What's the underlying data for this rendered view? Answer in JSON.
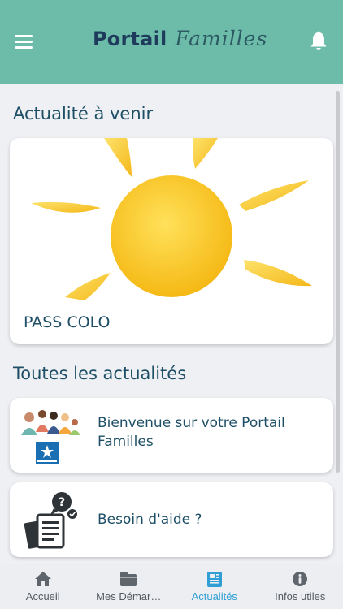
{
  "header": {
    "app_name_main": "Portail",
    "app_name_script": "Familles",
    "menu_icon": "hamburger-icon",
    "bell_icon": "bell-icon"
  },
  "upcoming": {
    "section_title": "Actualité à venir",
    "featured": {
      "title": "PASS COLO",
      "image": "sun-illustration"
    }
  },
  "all_news": {
    "section_title": "Toutes les actualités",
    "items": [
      {
        "title_line1": "Bienvenue sur votre Portail",
        "title_line2": "Familles",
        "image": "families-caf-illustration"
      },
      {
        "title_line1": "Besoin d'aide ?",
        "title_line2": "",
        "image": "help-documents-icon"
      }
    ]
  },
  "tabs": [
    {
      "label": "Accueil",
      "icon": "home-icon",
      "active": false
    },
    {
      "label": "Mes Démar…",
      "icon": "folder-icon",
      "active": false
    },
    {
      "label": "Actualités",
      "icon": "newspaper-icon",
      "active": true
    },
    {
      "label": "Infos utiles",
      "icon": "info-icon",
      "active": false
    }
  ],
  "colors": {
    "header": "#6dbcaa",
    "title_text": "#1e4f66",
    "active_tab": "#2f9fd6",
    "sun": "#f7c525"
  }
}
